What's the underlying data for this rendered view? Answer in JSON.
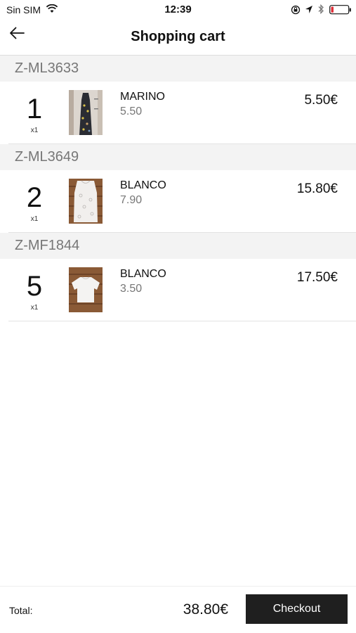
{
  "status_bar": {
    "carrier": "Sin SIM",
    "time": "12:39"
  },
  "header": {
    "title": "Shopping cart"
  },
  "cart": {
    "groups": [
      {
        "reference": "Z-ML3633",
        "items": [
          {
            "quantity": "1",
            "multiplier": "x1",
            "color": "MARINO",
            "unit_price": "5.50",
            "line_total": "5.50€",
            "thumbnail": "dark floral long dress"
          }
        ]
      },
      {
        "reference": "Z-ML3649",
        "items": [
          {
            "quantity": "2",
            "multiplier": "x1",
            "color": "BLANCO",
            "unit_price": "7.90",
            "line_total": "15.80€",
            "thumbnail": "white lace top"
          }
        ]
      },
      {
        "reference": "Z-MF1844",
        "items": [
          {
            "quantity": "5",
            "multiplier": "x1",
            "color": "BLANCO",
            "unit_price": "3.50",
            "line_total": "17.50€",
            "thumbnail": "white t-shirt"
          }
        ]
      }
    ]
  },
  "footer": {
    "total_label": "Total:",
    "total_value": "38.80€",
    "checkout_label": "Checkout"
  },
  "colors": {
    "group_header_bg": "#f3f3f3",
    "checkout_bg": "#1f1f1f",
    "muted_text": "#777777"
  }
}
